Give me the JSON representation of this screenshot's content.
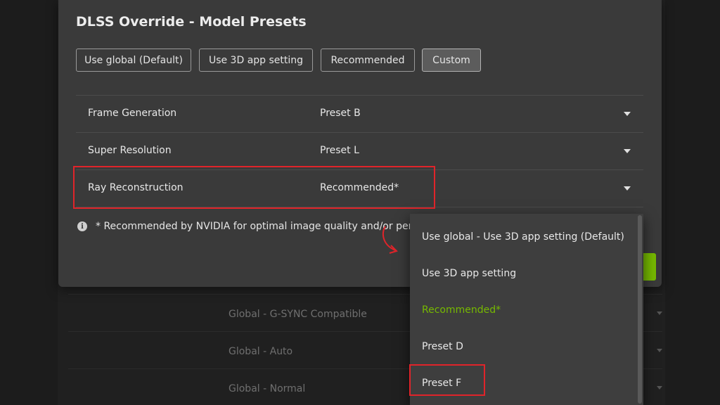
{
  "dialog": {
    "title": "DLSS Override - Model Presets",
    "mode_buttons": [
      {
        "label": "Use global (Default)",
        "selected": false
      },
      {
        "label": "Use 3D app setting",
        "selected": false
      },
      {
        "label": "Recommended",
        "selected": false
      },
      {
        "label": "Custom",
        "selected": true
      }
    ],
    "settings": [
      {
        "label": "Frame Generation",
        "value": "Preset B"
      },
      {
        "label": "Super Resolution",
        "value": "Preset L"
      },
      {
        "label": "Ray Reconstruction",
        "value": "Recommended*"
      }
    ],
    "footnote": "* Recommended by NVIDIA for optimal image quality and/or per",
    "footnote_icon": "info-icon"
  },
  "dropdown": {
    "options": [
      {
        "label": "Use global - Use 3D app setting (Default)"
      },
      {
        "label": "Use 3D app setting"
      },
      {
        "label": "Recommended*"
      },
      {
        "label": "Preset D"
      },
      {
        "label": "Preset F"
      }
    ]
  },
  "background_list": {
    "rows": [
      {
        "label": "Global - G-SYNC Compatible"
      },
      {
        "label": "Global - Auto"
      },
      {
        "label": "Global - Normal"
      }
    ]
  },
  "colors": {
    "accent_green": "#76b900",
    "highlight_red": "#e0242a",
    "dialog_bg": "#3a3a3a"
  }
}
